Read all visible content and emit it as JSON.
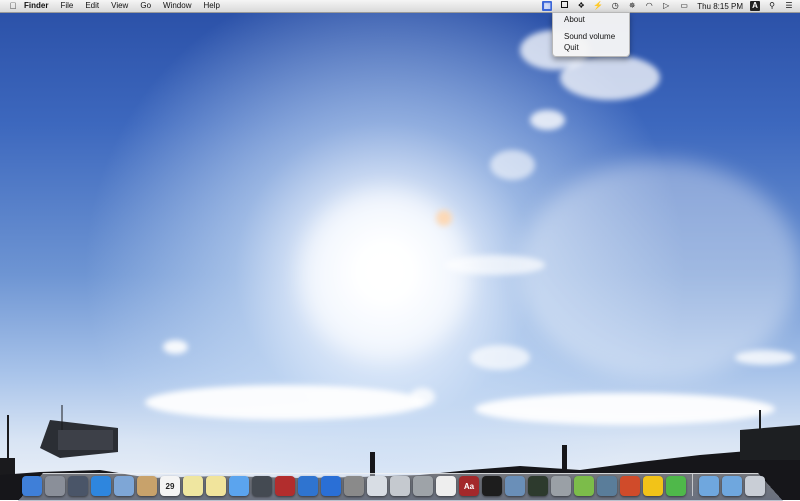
{
  "menubar": {
    "apple_icon": "apple-icon",
    "app_name": "Finder",
    "menus": [
      "File",
      "Edit",
      "View",
      "Go",
      "Window",
      "Help"
    ],
    "status_icons": [
      "volume-menu-icon",
      "window-icon",
      "evernote-icon",
      "bolt-icon",
      "time-machine-icon",
      "bluetooth-icon",
      "wifi-icon",
      "volume-icon",
      "battery-icon"
    ],
    "clock": "Thu 8:15 PM",
    "input_badge": "A",
    "spotlight_icon": "search-icon",
    "notification_icon": "list-icon"
  },
  "dropdown": {
    "items": [
      "About",
      "Sound volume",
      "Quit"
    ]
  },
  "dock": {
    "apps": [
      {
        "icon": "finder-icon",
        "color": "#3f7fd8"
      },
      {
        "icon": "launchpad-icon",
        "color": "#8a8f99"
      },
      {
        "icon": "mission-control-icon",
        "color": "#4a5568"
      },
      {
        "icon": "safari-icon",
        "color": "#2e86de"
      },
      {
        "icon": "mail-icon",
        "color": "#7ea6d6"
      },
      {
        "icon": "contacts-icon",
        "color": "#c8a26b"
      },
      {
        "icon": "calendar-icon",
        "color": "#f4f4f4",
        "label": "29"
      },
      {
        "icon": "notes-icon",
        "color": "#efe6a0"
      },
      {
        "icon": "reminders-icon",
        "color": "#f1e49c"
      },
      {
        "icon": "messages-icon",
        "color": "#5ba4ee"
      },
      {
        "icon": "facetime-icon",
        "color": "#444a52"
      },
      {
        "icon": "photo-booth-icon",
        "color": "#b22d2d"
      },
      {
        "icon": "itunes-icon",
        "color": "#2f74d0"
      },
      {
        "icon": "app-store-icon",
        "color": "#2a6fd6"
      },
      {
        "icon": "system-preferences-icon",
        "color": "#8a8a8a"
      },
      {
        "icon": "preview-icon",
        "color": "#d8dde4"
      },
      {
        "icon": "activity-icon",
        "color": "#c5c9cf"
      },
      {
        "icon": "calculator-icon",
        "color": "#9ea3a8"
      },
      {
        "icon": "textedit-icon",
        "color": "#eeeeee"
      },
      {
        "icon": "dictionary-icon",
        "color": "#a3282a",
        "label": "Aa"
      },
      {
        "icon": "terminal-icon",
        "color": "#1d1d1d"
      },
      {
        "icon": "xcode-icon",
        "color": "#6a8fb8"
      },
      {
        "icon": "activity-monitor-icon",
        "color": "#2d3a2d"
      },
      {
        "icon": "disk-utility-icon",
        "color": "#9aa0a6"
      },
      {
        "icon": "script-editor-icon",
        "color": "#7cbc4a"
      },
      {
        "icon": "photo-browser-icon",
        "color": "#5a7d9a"
      },
      {
        "icon": "stickies-icon",
        "color": "#d04b2a"
      },
      {
        "icon": "cyberduck-icon",
        "color": "#f2c318"
      },
      {
        "icon": "cube-icon",
        "color": "#4fb84a"
      }
    ],
    "stacks": [
      {
        "icon": "folder-icon",
        "color": "#6fa7de"
      },
      {
        "icon": "downloads-folder-icon",
        "color": "#6fa7de"
      },
      {
        "icon": "trash-icon",
        "color": "#c9ced6"
      }
    ]
  }
}
